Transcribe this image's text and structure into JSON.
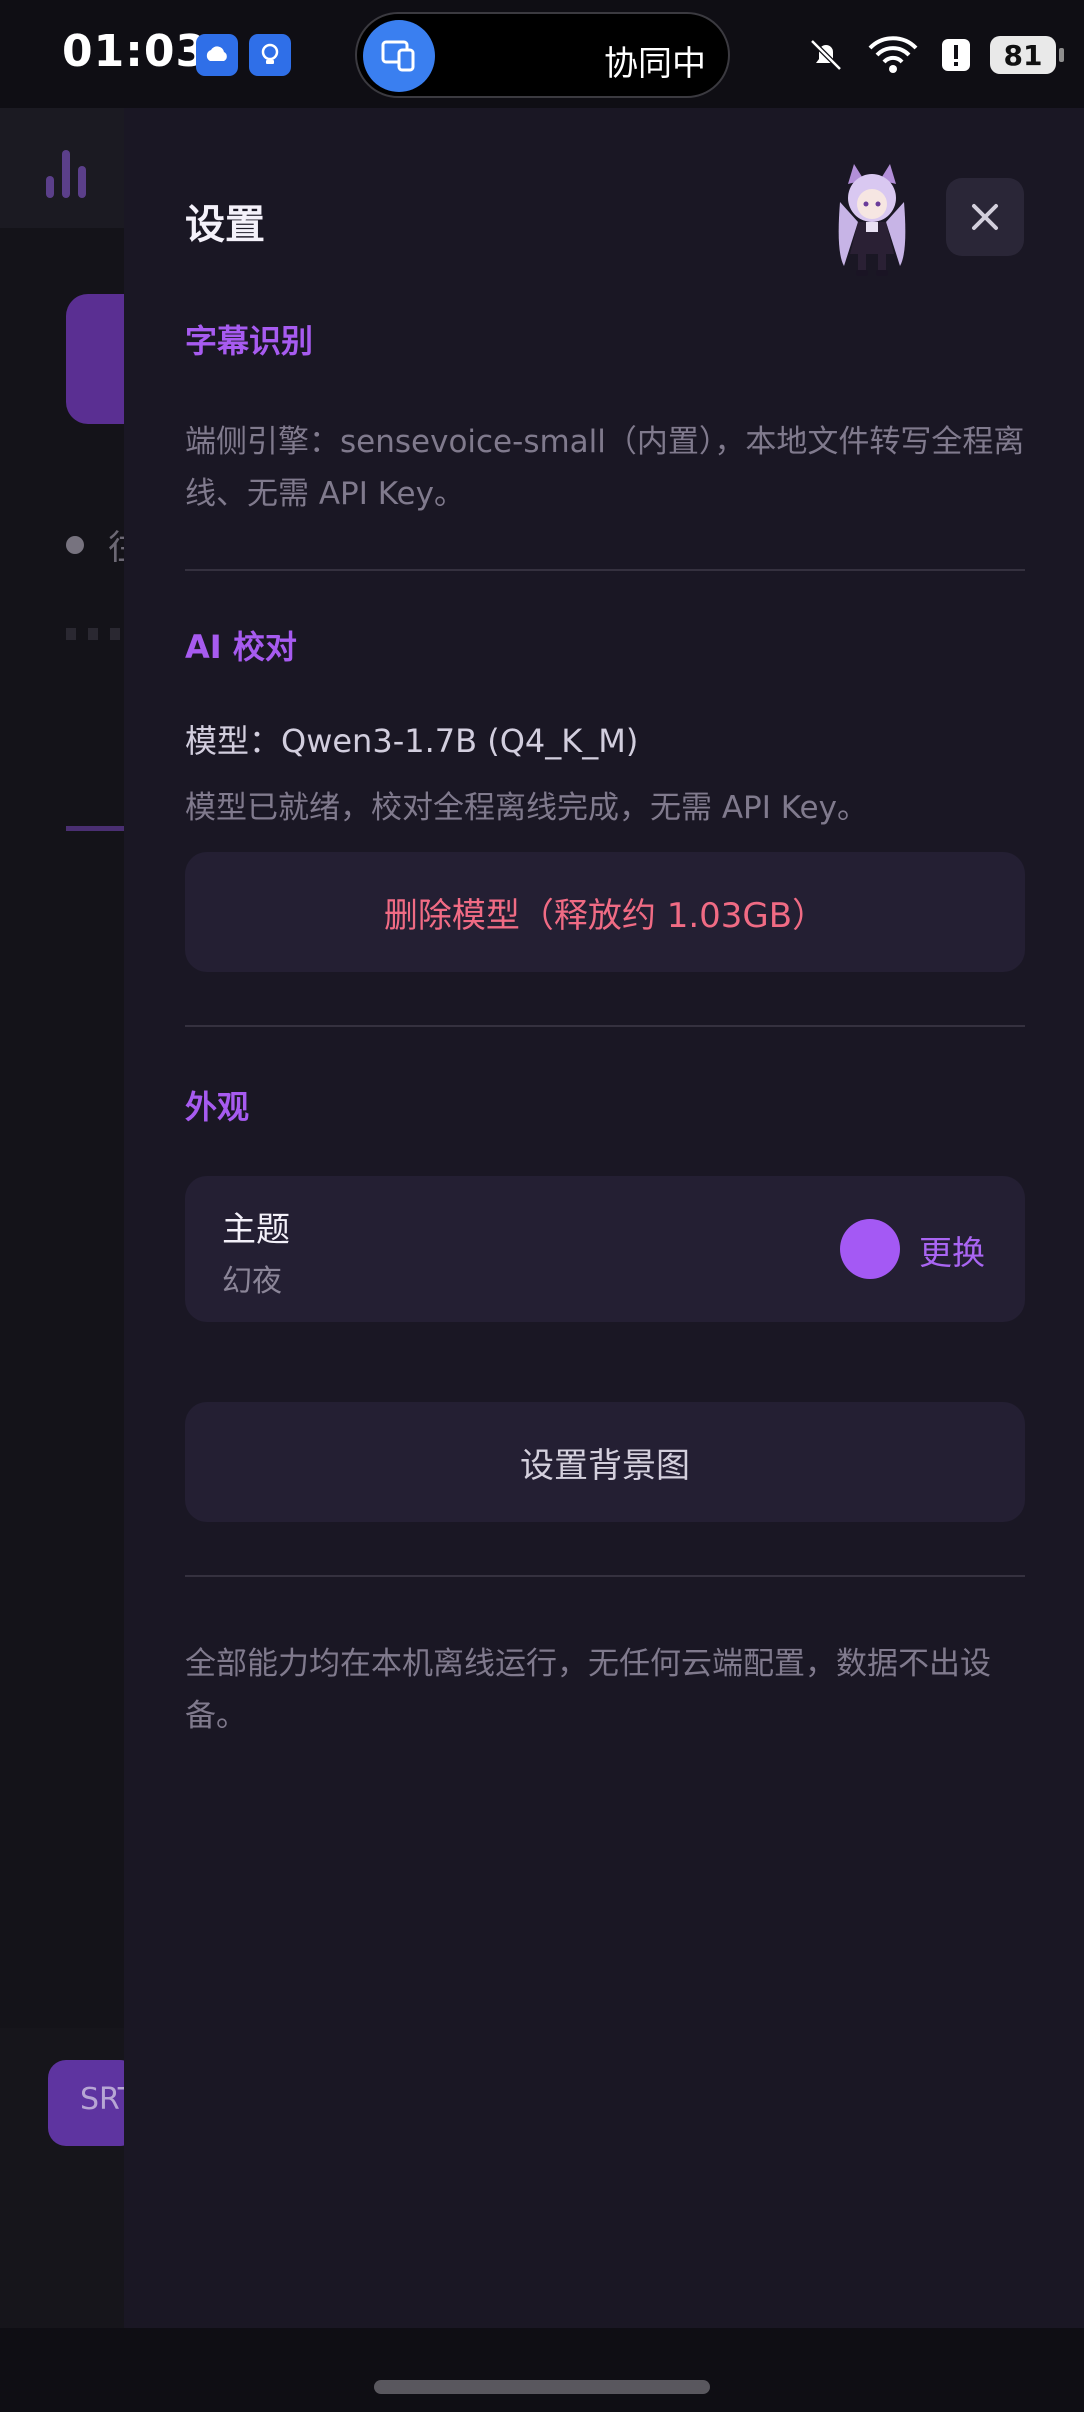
{
  "status_bar": {
    "time": "01:03",
    "island_text": "协同中",
    "battery": "81"
  },
  "background_app": {
    "partial_char": "往",
    "srt_button": "SRT"
  },
  "settings": {
    "title": "设置",
    "close_icon": "close-icon",
    "subtitle_section": {
      "heading": "字幕识别",
      "description": "端侧引擎：sensevoice-small（内置），本地文件转写全程离线、无需 API Key。"
    },
    "ai_section": {
      "heading": "AI 校对",
      "model_line": "模型：Qwen3-1.7B (Q4_K_M)",
      "status": "模型已就绪，校对全程离线完成，无需 API Key。",
      "delete_button": "删除模型（释放约 1.03GB）"
    },
    "appearance_section": {
      "heading": "外观",
      "theme_label": "主题",
      "theme_value": "幻夜",
      "theme_color": "#a459f4",
      "change_button": "更换",
      "background_button": "设置背景图"
    },
    "footer_note": "全部能力均在本机离线运行，无任何云端配置，数据不出设备。"
  },
  "colors": {
    "accent": "#a75bf0",
    "danger": "#f06b84",
    "drawer_bg": "#1a1724",
    "card_bg": "#241f33"
  }
}
